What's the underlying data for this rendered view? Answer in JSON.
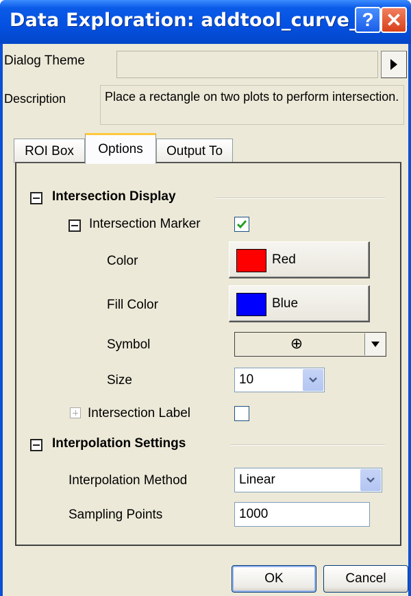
{
  "window": {
    "title": "Data Exploration: addtool_curve_int...",
    "help_label": "?",
    "close_label": "✕"
  },
  "dialog_theme": {
    "label": "Dialog Theme",
    "value": ""
  },
  "description": {
    "label": "Description",
    "text": "Place a rectangle on two plots to perform intersection."
  },
  "tabs": [
    {
      "label": "ROI Box",
      "active": false
    },
    {
      "label": "Options",
      "active": true
    },
    {
      "label": "Output To",
      "active": false
    }
  ],
  "intersection_display": {
    "title": "Intersection Display",
    "marker": {
      "label": "Intersection Marker",
      "checked": true
    },
    "color": {
      "label": "Color",
      "value": "Red",
      "swatch": "#ff0000"
    },
    "fill_color": {
      "label": "Fill Color",
      "value": "Blue",
      "swatch": "#0000ff"
    },
    "symbol": {
      "label": "Symbol",
      "value": "⊕"
    },
    "size": {
      "label": "Size",
      "value": "10"
    },
    "label_row": {
      "label": "Intersection Label",
      "checked": false
    }
  },
  "interpolation": {
    "title": "Interpolation Settings",
    "method": {
      "label": "Interpolation Method",
      "value": "Linear"
    },
    "sampling": {
      "label": "Sampling Points",
      "value": "1000"
    }
  },
  "buttons": {
    "ok": "OK",
    "cancel": "Cancel"
  },
  "colors": {
    "title_bar": "#0450e0",
    "face": "#ece9d8",
    "check": "#21a121"
  }
}
